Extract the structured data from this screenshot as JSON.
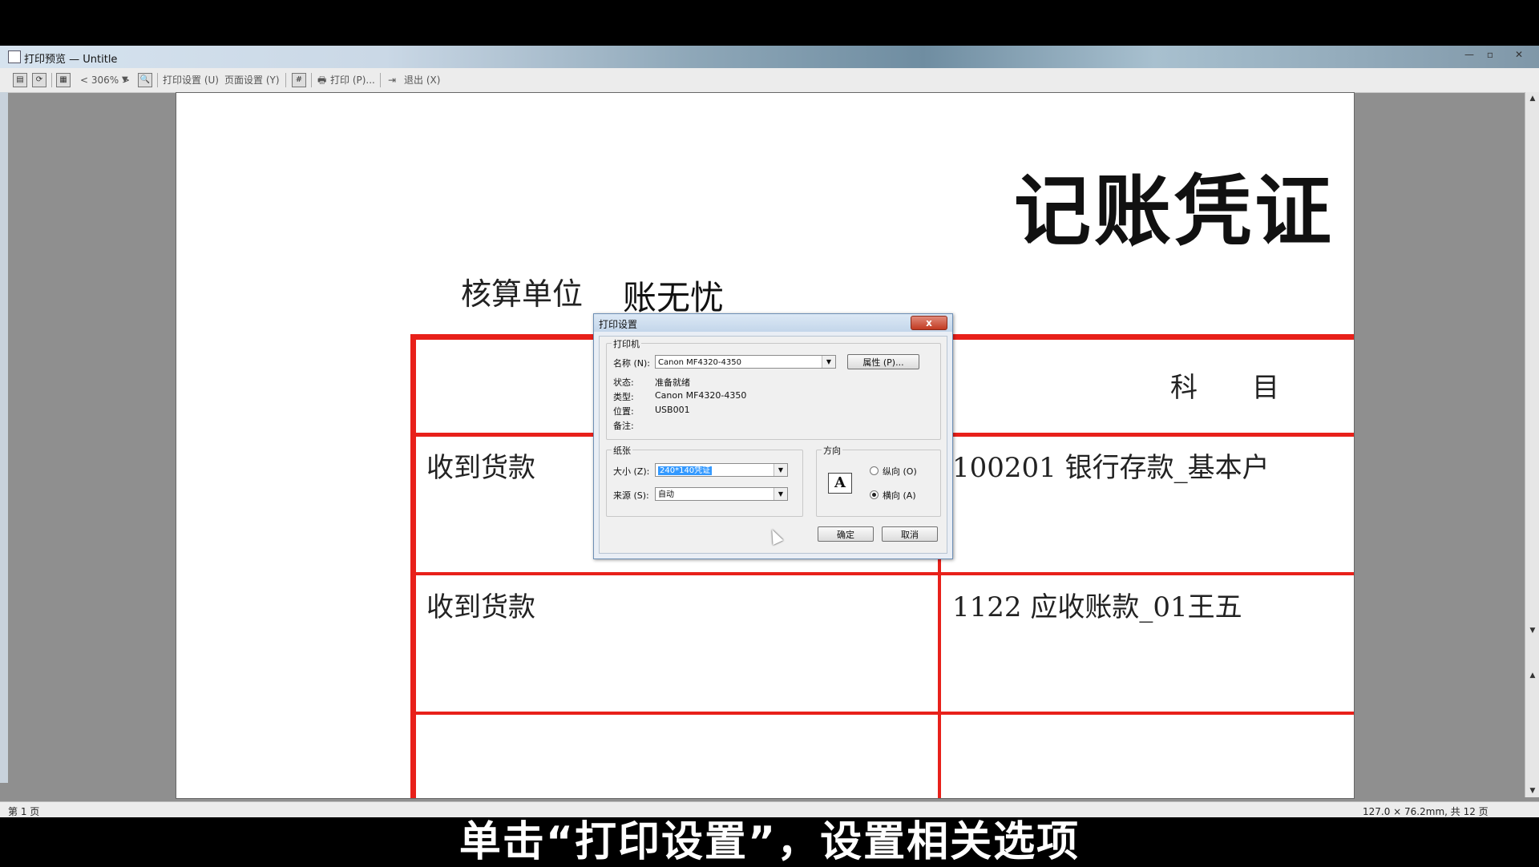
{
  "window": {
    "title": "打印预览 — Untitle"
  },
  "toolbar": {
    "zoom": "< 306% >",
    "print_setup": "打印设置 (U)",
    "page_setup": "页面设置 (Y)",
    "print": "打印 (P)...",
    "exit": "退出 (X)"
  },
  "document": {
    "title": "记账凭证",
    "unit_label": "核算单位",
    "unit_value": "账无忧",
    "subject_header": "科　　目",
    "rows": [
      {
        "summary": "收到货款",
        "account": "100201  银行存款_基本户"
      },
      {
        "summary": "收到货款",
        "account": "1122  应收账款_01王五"
      }
    ]
  },
  "dialog": {
    "title": "打印设置",
    "close": "x",
    "printer_group": "打印机",
    "name_label": "名称 (N):",
    "name_value": "Canon MF4320-4350",
    "properties_button": "属性 (P)...",
    "status_label": "状态:",
    "status_value": "准备就绪",
    "type_label": "类型:",
    "type_value": "Canon MF4320-4350",
    "location_label": "位置:",
    "location_value": "USB001",
    "comment_label": "备注:",
    "paper_group": "纸张",
    "size_label": "大小 (Z):",
    "size_value": "240*140凭证",
    "source_label": "来源 (S):",
    "source_value": "自动",
    "orientation_group": "方向",
    "portrait_label": "纵向 (O)",
    "landscape_label": "横向 (A)",
    "orientation_selected": "横向 (A)",
    "ok_button": "确定",
    "cancel_button": "取消"
  },
  "statusbar": {
    "page": "第 1 页",
    "info": "127.0 × 76.2mm, 共 12 页"
  },
  "subtitle": "单击“打印设置”，设置相关选项"
}
